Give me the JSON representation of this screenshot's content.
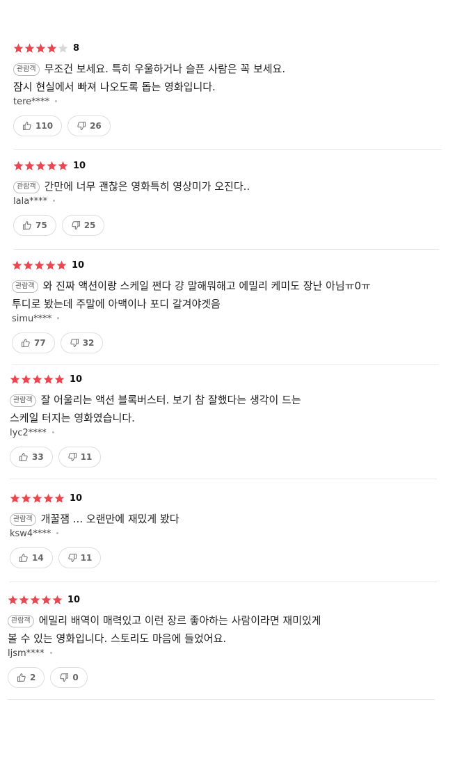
{
  "colors": {
    "star_filled": "#e9464f",
    "star_empty": "#d8d8d8"
  },
  "icons": {
    "star": "star-icon",
    "like": "thumbs-up-icon",
    "dislike": "thumbs-down-icon"
  },
  "reviews": [
    {
      "stars": 4,
      "score": "8",
      "tag": "관람객",
      "text_lines": [
        "무조건 보세요. 특히 우울하거나 슬픈 사람은 꼭 보세요.",
        "잠시 현실에서 빠져 나오도록 돕는 영화입니다."
      ],
      "author": "tere****",
      "likes": "110",
      "dislikes": "26"
    },
    {
      "stars": 5,
      "score": "10",
      "tag": "관람객",
      "text_lines": [
        "간만에 너무 괜찮은 영화특히 영상미가 오진다.."
      ],
      "author": "lala****",
      "likes": "75",
      "dislikes": "25"
    },
    {
      "stars": 5,
      "score": "10",
      "tag": "관람객",
      "text_lines": [
        "와 진짜 액션이랑 스케일 쩐다  걍 말해뭐해고 에밀리 케미도 장난 아님ㅠ0ㅠ",
        "투디로 봤는데 주말에 아맥이나 포디 갈겨야겟음"
      ],
      "author": "simu****",
      "likes": "77",
      "dislikes": "32"
    },
    {
      "stars": 5,
      "score": "10",
      "tag": "관람객",
      "text_lines": [
        "잘 어울리는 액션 블록버스터. 보기 참 잘했다는 생각이 드는",
        "스케일 터지는 영화였습니다."
      ],
      "author": "lyc2****",
      "likes": "33",
      "dislikes": "11"
    },
    {
      "stars": 5,
      "score": "10",
      "tag": "관람객",
      "text_lines": [
        "개꿀잼 ... 오랜만에 재밌게 봤다"
      ],
      "author": "ksw4****",
      "likes": "14",
      "dislikes": "11"
    },
    {
      "stars": 5,
      "score": "10",
      "tag": "관람객",
      "text_lines": [
        "에밀리 배역이 매력있고 이런 장르 좋아하는 사람이라면 재미있게",
        "볼 수 있는 영화입니다. 스토리도 마음에 들었어요."
      ],
      "author": "ljsm****",
      "likes": "2",
      "dislikes": "0"
    }
  ]
}
